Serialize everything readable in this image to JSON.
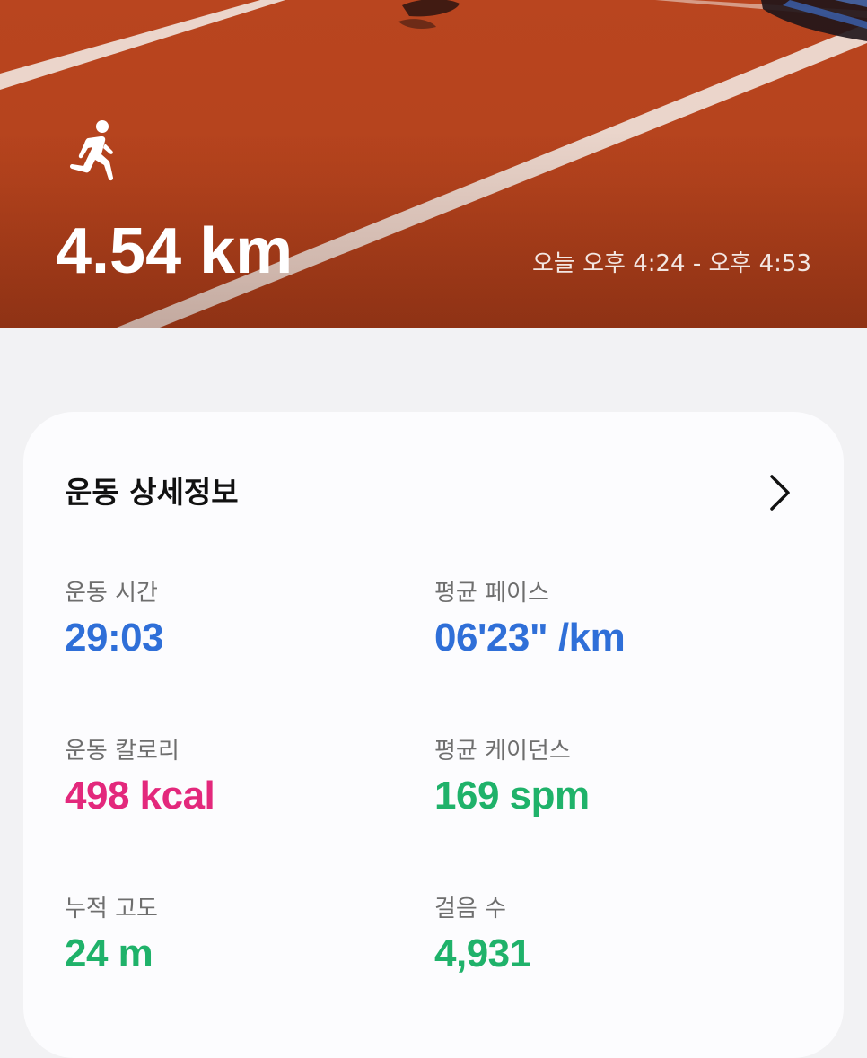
{
  "hero": {
    "distance": "4.54 km",
    "time_range": "오늘 오후 4:24 - 오후 4:53",
    "activity_icon": "running-person-icon",
    "background": "running-track-photo",
    "colors": {
      "track": "#b5431d",
      "lines": "#f2e4dc",
      "text": "#ffffff"
    }
  },
  "details": {
    "title": "운동 상세정보",
    "more_icon": "chevron-right-icon",
    "stats": {
      "duration": {
        "label": "운동 시간",
        "value": "29:03",
        "color": "#2f6fd8"
      },
      "pace": {
        "label": "평균 페이스",
        "value": "06'23\" /km",
        "color": "#2f6fd8"
      },
      "calories": {
        "label": "운동 칼로리",
        "value": "498 kcal",
        "color": "#e3287c"
      },
      "cadence": {
        "label": "평균 케이던스",
        "value": "169 spm",
        "color": "#1fb26a"
      },
      "elevation": {
        "label": "누적 고도",
        "value": "24 m",
        "color": "#1fb26a"
      },
      "steps": {
        "label": "걸음 수",
        "value": "4,931",
        "color": "#1fb26a"
      }
    }
  }
}
